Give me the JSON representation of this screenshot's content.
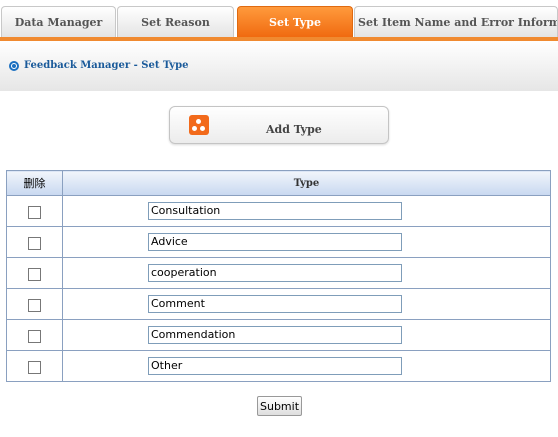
{
  "tabs": [
    {
      "label": "Data Manager",
      "active": false
    },
    {
      "label": "Set Reason",
      "active": false
    },
    {
      "label": "Set Type",
      "active": true
    },
    {
      "label": "Set Item Name and Error Information",
      "active": false
    }
  ],
  "breadcrumb": "Feedback Manager - Set Type",
  "add_type_label": "Add Type",
  "table": {
    "headers": {
      "delete": "删除",
      "type": "Type"
    },
    "rows": [
      {
        "checked": false,
        "type": "Consultation"
      },
      {
        "checked": false,
        "type": "Advice"
      },
      {
        "checked": false,
        "type": "cooperation"
      },
      {
        "checked": false,
        "type": "Comment"
      },
      {
        "checked": false,
        "type": "Commendation"
      },
      {
        "checked": false,
        "type": "Other"
      }
    ]
  },
  "submit_label": "Submit",
  "colors": {
    "accent": "#f26a1b",
    "link": "#1a5a9a",
    "table_border": "#8aa0c0"
  }
}
